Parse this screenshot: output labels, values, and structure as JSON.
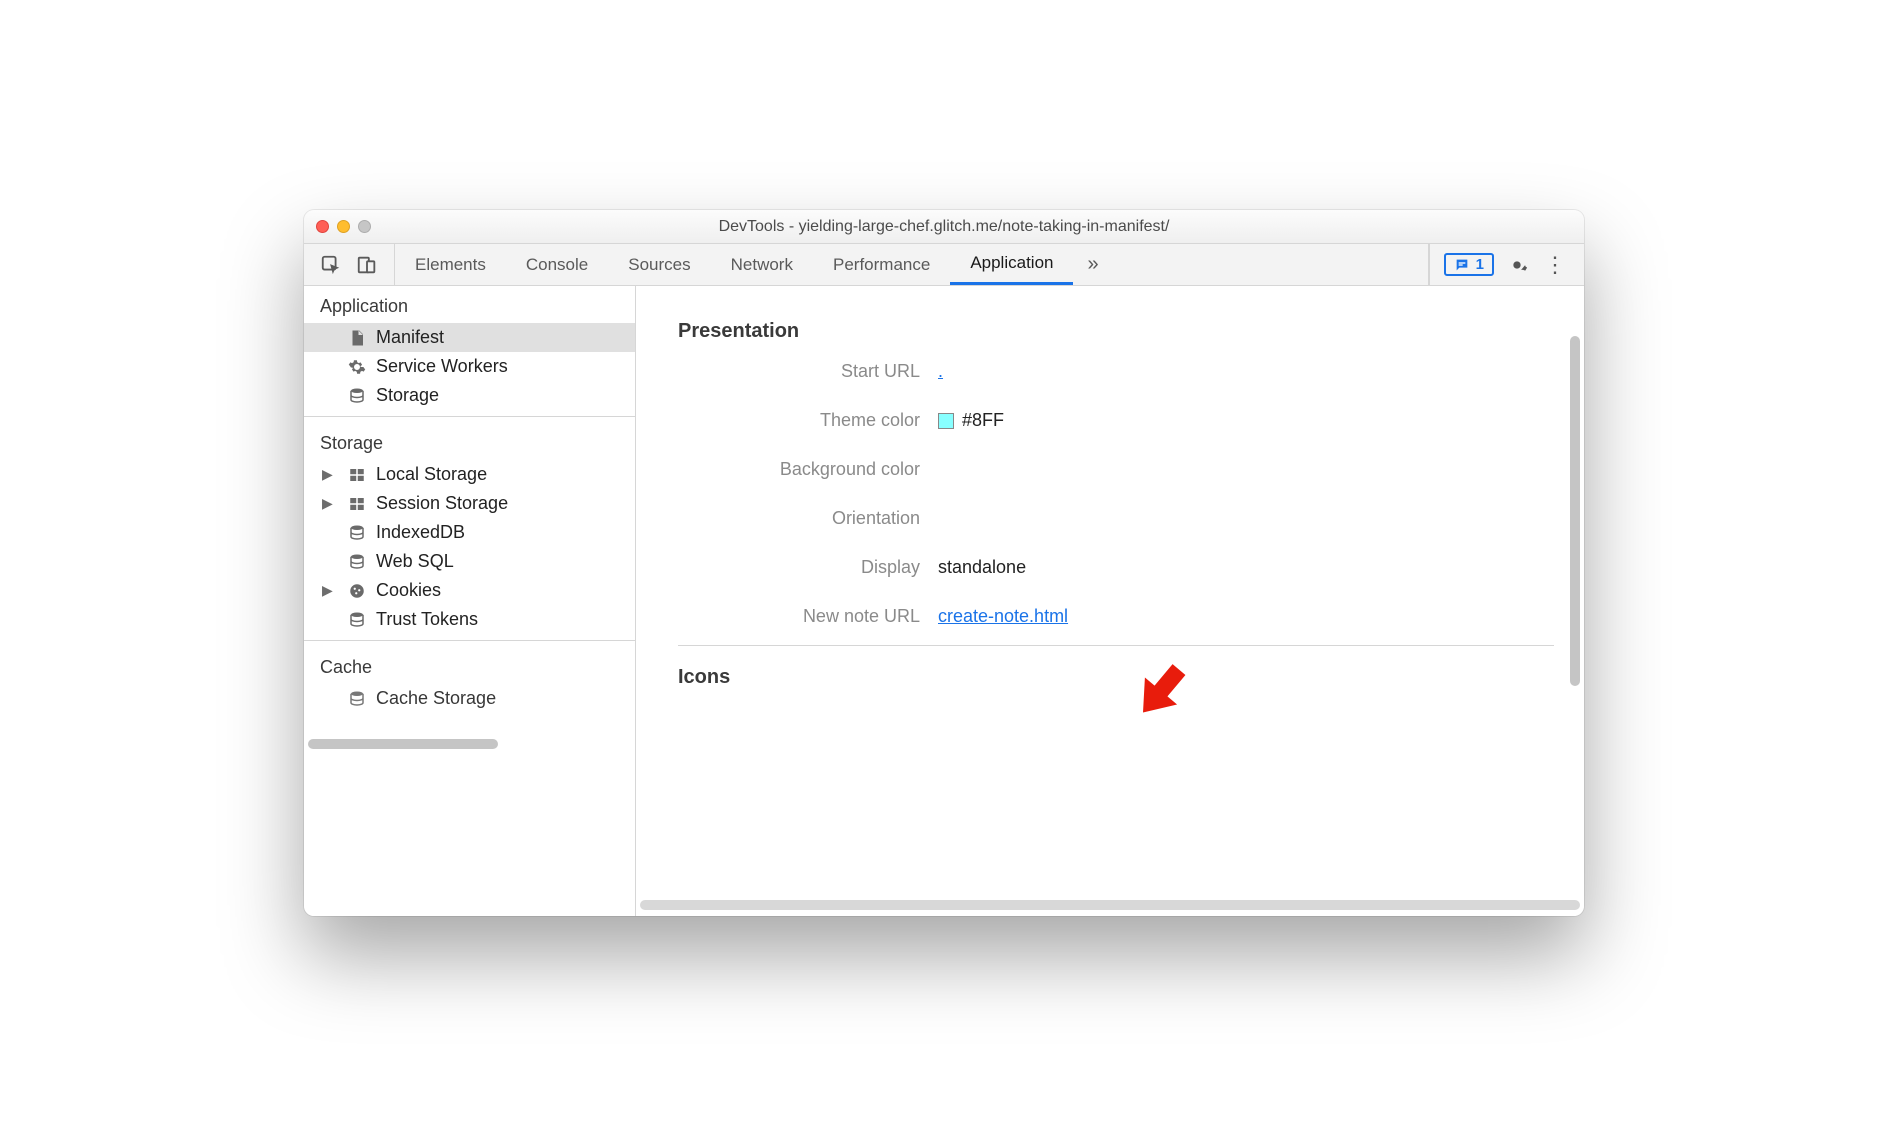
{
  "window": {
    "title": "DevTools - yielding-large-chef.glitch.me/note-taking-in-manifest/"
  },
  "tabs": {
    "items": [
      "Elements",
      "Console",
      "Sources",
      "Network",
      "Performance",
      "Application"
    ],
    "active_index": 5,
    "overflow_glyph": "»"
  },
  "toolbar": {
    "message_count": "1"
  },
  "sidebar": {
    "groups": [
      {
        "title": "Application",
        "items": [
          {
            "label": "Manifest",
            "icon": "file-icon",
            "selected": true
          },
          {
            "label": "Service Workers",
            "icon": "gear-icon"
          },
          {
            "label": "Storage",
            "icon": "database-icon"
          }
        ]
      },
      {
        "title": "Storage",
        "items": [
          {
            "label": "Local Storage",
            "icon": "grid-icon",
            "expandable": true
          },
          {
            "label": "Session Storage",
            "icon": "grid-icon",
            "expandable": true
          },
          {
            "label": "IndexedDB",
            "icon": "database-icon"
          },
          {
            "label": "Web SQL",
            "icon": "database-icon"
          },
          {
            "label": "Cookies",
            "icon": "cookie-icon",
            "expandable": true
          },
          {
            "label": "Trust Tokens",
            "icon": "database-icon"
          }
        ]
      },
      {
        "title": "Cache",
        "items": [
          {
            "label": "Cache Storage",
            "icon": "database-icon"
          }
        ]
      }
    ]
  },
  "main": {
    "section_title_1": "Presentation",
    "presentation": {
      "start_url_label": "Start URL",
      "start_url_value": ".",
      "theme_color_label": "Theme color",
      "theme_color_value": "#8FF",
      "theme_color_swatch": "#88ffff",
      "bg_color_label": "Background color",
      "bg_color_value": "",
      "orientation_label": "Orientation",
      "orientation_value": "",
      "display_label": "Display",
      "display_value": "standalone",
      "new_note_label": "New note URL",
      "new_note_value": "create-note.html"
    },
    "section_title_2": "Icons"
  }
}
